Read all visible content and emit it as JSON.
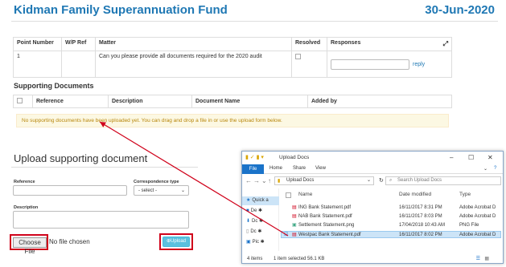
{
  "header": {
    "title": "Kidman Family Superannuation Fund",
    "date": "30-Jun-2020"
  },
  "query_table": {
    "headers": [
      "Point Number",
      "W/P Ref",
      "Matter",
      "Resolved",
      "Responses"
    ],
    "rows": [
      {
        "point": "1",
        "wp_ref": "",
        "matter": "Can you please provide all documents required for the 2020 audit",
        "reply": "reply"
      }
    ]
  },
  "supporting": {
    "title": "Supporting Documents",
    "headers": [
      "Reference",
      "Description",
      "Document Name",
      "Added by"
    ],
    "empty_message": "No supporting documents have been uploaded yet. You can drag and drop a file in or use the upload form below."
  },
  "upload_form": {
    "title": "Upload supporting document",
    "reference_label": "Reference",
    "correspondence_label": "Correspondence type",
    "correspondence_value": "- select -",
    "description_label": "Description",
    "choose_file": "Choose File",
    "no_file": "No file chosen",
    "upload_button": "Upload"
  },
  "explorer": {
    "title": "Upload Docs",
    "ribbon_tabs": [
      "File",
      "Home",
      "Share",
      "View"
    ],
    "address": "Upload Docs",
    "search_placeholder": "Search Upload Docs",
    "sidebar": [
      {
        "label": "Quick a"
      },
      {
        "label": "De"
      },
      {
        "label": "Dc"
      },
      {
        "label": "Dc"
      },
      {
        "label": "Pic"
      }
    ],
    "columns": [
      "Name",
      "Date modified",
      "Type"
    ],
    "files": [
      {
        "name": "ING Bank Statement.pdf",
        "date": "16/11/2017 8:31 PM",
        "type": "Adobe Acrobat D",
        "kind": "pdf",
        "selected": false
      },
      {
        "name": "NAB Bank Statement.pdf",
        "date": "16/11/2017 8:03 PM",
        "type": "Adobe Acrobat D",
        "kind": "pdf",
        "selected": false
      },
      {
        "name": "Settlement Statement.png",
        "date": "17/04/2018 10:43 AM",
        "type": "PNG File",
        "kind": "png",
        "selected": false
      },
      {
        "name": "Westpac Bank Statement.pdf",
        "date": "16/11/2017 8:02 PM",
        "type": "Adobe Acrobat D",
        "kind": "pdf",
        "selected": true
      }
    ],
    "status_items": "4 items",
    "status_selected": "1 item selected  56.1 KB"
  },
  "colors": {
    "brand": "#1f78b4",
    "highlight": "#d0021b",
    "upload": "#5bc0de",
    "warning_bg": "#fcf8e3"
  }
}
